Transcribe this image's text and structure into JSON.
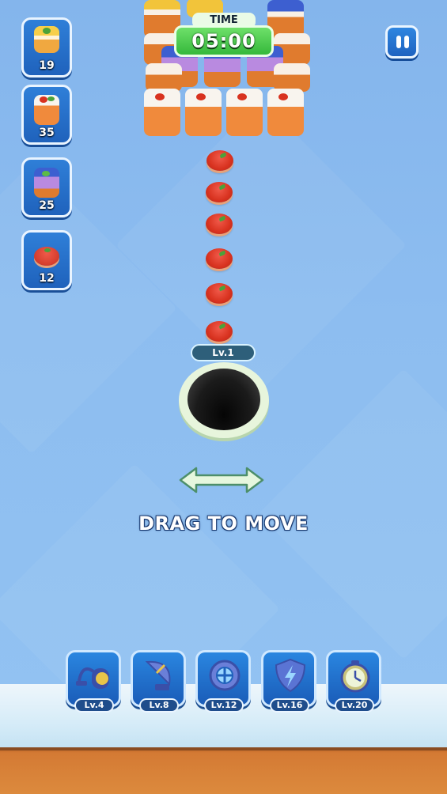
{
  "timer": {
    "label": "TIME",
    "value": "05:00"
  },
  "goals": [
    {
      "count": "19",
      "icon": "lemon-cake-icon"
    },
    {
      "count": "35",
      "icon": "cherry-cake-icon"
    },
    {
      "count": "25",
      "icon": "blueberry-cake-icon"
    },
    {
      "count": "12",
      "icon": "tomato-slice-icon"
    }
  ],
  "hole": {
    "level": "Lv.1"
  },
  "hint": "DRAG TO MOVE",
  "boosters": [
    {
      "level": "Lv.4",
      "icon": "vacuum-icon"
    },
    {
      "level": "Lv.8",
      "icon": "satellite-dish-icon"
    },
    {
      "level": "Lv.12",
      "icon": "magnet-scope-icon"
    },
    {
      "level": "Lv.16",
      "icon": "shield-icon"
    },
    {
      "level": "Lv.20",
      "icon": "stopwatch-icon"
    }
  ],
  "colors": {
    "background": "#8dbdf0",
    "timer": "#35b83b",
    "button": "#1f62bc",
    "dirt": "#d47a34"
  }
}
